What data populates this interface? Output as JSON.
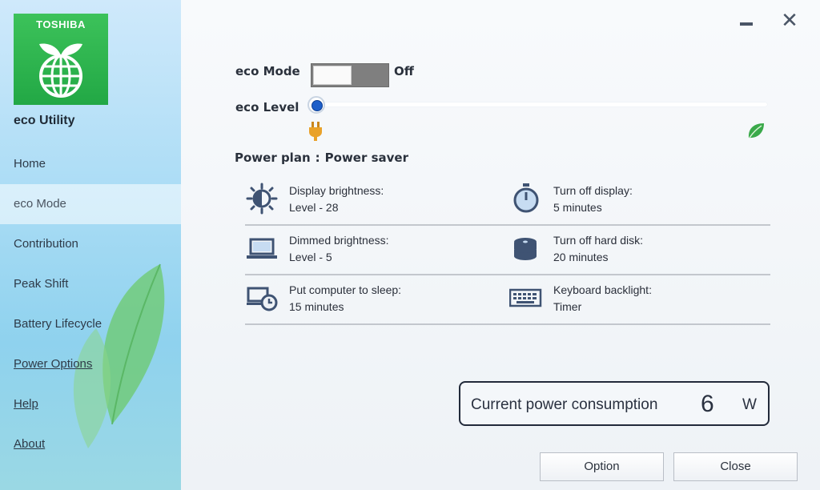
{
  "sidebar": {
    "logo_text": "TOSHIBA",
    "app_title": "eco Utility",
    "items": [
      {
        "label": "Home"
      },
      {
        "label": "eco Mode"
      },
      {
        "label": "Contribution"
      },
      {
        "label": "Peak Shift"
      },
      {
        "label": "Battery Lifecycle"
      },
      {
        "label": "Power Options"
      },
      {
        "label": "Help"
      },
      {
        "label": "About"
      }
    ],
    "active_item": "eco Mode"
  },
  "window": {
    "close_glyph": "✕"
  },
  "eco_mode": {
    "label": "eco Mode",
    "state": "Off",
    "enabled": false
  },
  "eco_level": {
    "label": "eco Level",
    "level": 0
  },
  "power_plan": {
    "label": "Power plan",
    "separator": ":",
    "value": "Power saver"
  },
  "settings": [
    {
      "icon": "brightness-icon",
      "label": "Display brightness:",
      "value": "Level - 28"
    },
    {
      "icon": "stopwatch-icon",
      "label": "Turn off display:",
      "value": "5 minutes"
    },
    {
      "icon": "laptop-icon",
      "label": "Dimmed brightness:",
      "value": "Level - 5"
    },
    {
      "icon": "hard-disk-icon",
      "label": "Turn off hard disk:",
      "value": "20 minutes"
    },
    {
      "icon": "sleep-clock-icon",
      "label": "Put computer to sleep:",
      "value": "15 minutes"
    },
    {
      "icon": "keyboard-icon",
      "label": "Keyboard backlight:",
      "value": "Timer"
    }
  ],
  "power_consumption": {
    "label": "Current power consumption",
    "value": "6",
    "unit": "W"
  },
  "buttons": {
    "option": "Option",
    "close": "Close"
  },
  "colors": {
    "logo_green": "#22a845",
    "slider_blue": "#1e5fc9",
    "plug_orange": "#e9a22a",
    "leaf_green": "#3aa94a"
  }
}
